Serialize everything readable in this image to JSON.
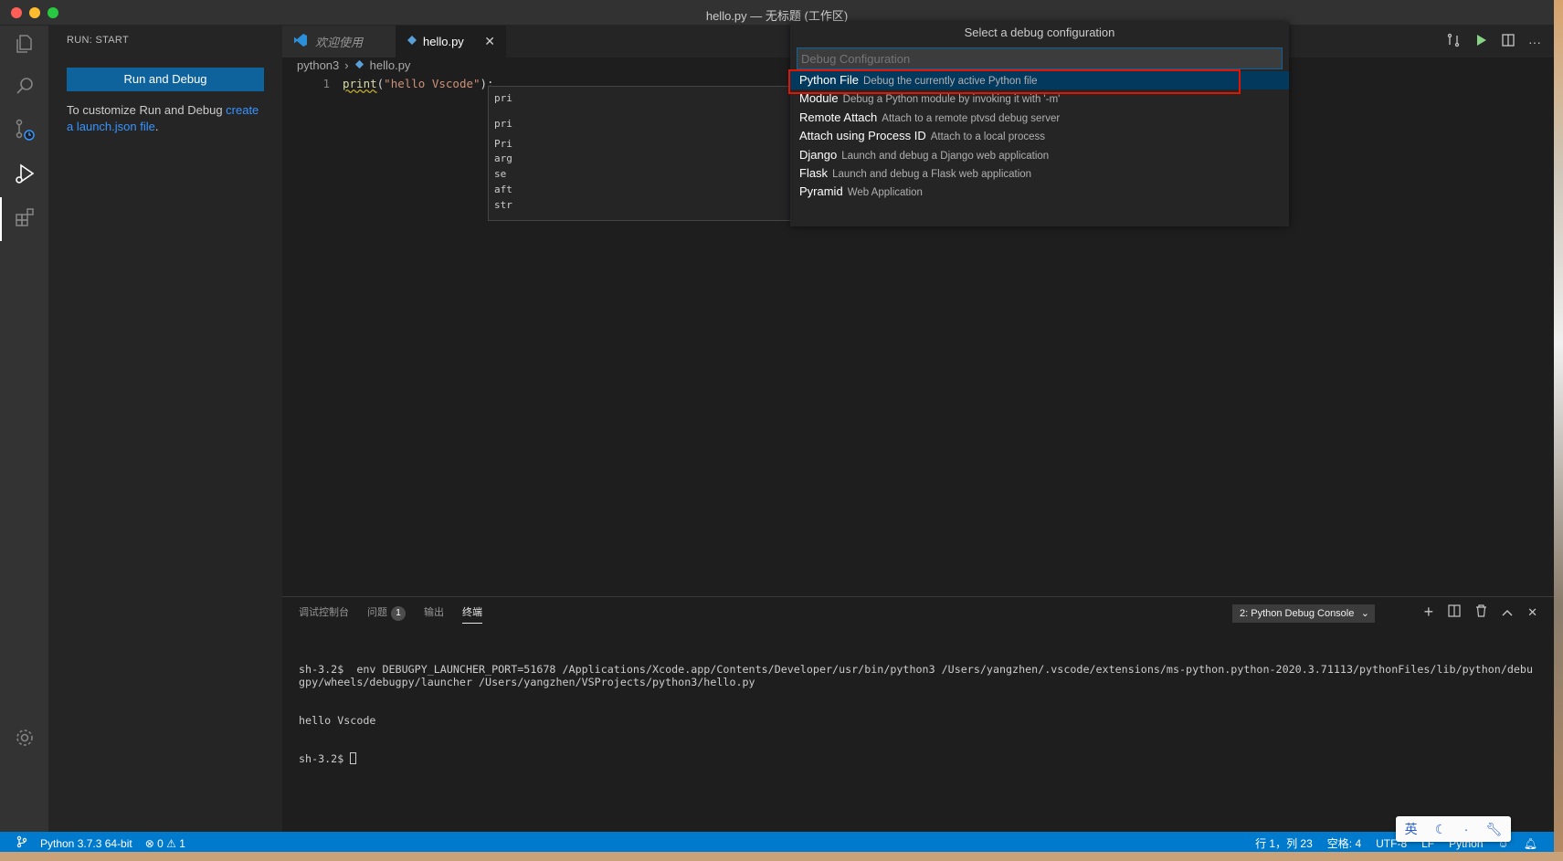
{
  "window": {
    "title": "hello.py — 无标题 (工作区)"
  },
  "sidebar": {
    "title": "RUN: START",
    "run_button": "Run and Debug",
    "hint_prefix": "To customize Run and Debug ",
    "hint_link": "create a launch.json file",
    "hint_suffix": "."
  },
  "tabs": [
    {
      "label": "欢迎使用"
    },
    {
      "label": "hello.py"
    }
  ],
  "breadcrumb": {
    "folder": "python3",
    "file": "hello.py"
  },
  "editor": {
    "line_number": "1",
    "code_fn": "print",
    "code_open": "(",
    "code_str": "\"hello Vscode\"",
    "code_close": ");"
  },
  "suggest": {
    "lines": [
      "pri",
      "pri",
      "Pri",
      "arg",
      "se",
      "aft",
      "str"
    ]
  },
  "quick_pick": {
    "title": "Select a debug configuration",
    "placeholder": "Debug Configuration",
    "items": [
      {
        "label": "Python File",
        "description": "Debug the currently active Python file"
      },
      {
        "label": "Module",
        "description": "Debug a Python module by invoking it with '-m'"
      },
      {
        "label": "Remote Attach",
        "description": "Attach to a remote ptvsd debug server"
      },
      {
        "label": "Attach using Process ID",
        "description": "Attach to a local process"
      },
      {
        "label": "Django",
        "description": "Launch and debug a Django web application"
      },
      {
        "label": "Flask",
        "description": "Launch and debug a Flask web application"
      },
      {
        "label": "Pyramid",
        "description": "Web Application"
      }
    ]
  },
  "panel": {
    "tabs": [
      "调试控制台",
      "问题",
      "输出",
      "终端"
    ],
    "problems_count": "1",
    "terminal_select": "2: Python Debug Console",
    "terminal_lines": [
      "sh-3.2$  env DEBUGPY_LAUNCHER_PORT=51678 /Applications/Xcode.app/Contents/Developer/usr/bin/python3 /Users/yangzhen/.vscode/extensions/ms-python.python-2020.3.71113/pythonFiles/lib/python/debugpy/wheels/debugpy/launcher /Users/yangzhen/VSProjects/python3/hello.py",
      "hello Vscode"
    ],
    "prompt": "sh-3.2$ "
  },
  "statusbar": {
    "interpreter": "Python 3.7.3 64-bit",
    "errors": "0",
    "warnings": "1",
    "position": "行 1，列 23",
    "indent": "空格: 4",
    "encoding": "UTF-8",
    "eol": "LF",
    "language": "Python"
  },
  "ime": {
    "label": "英"
  },
  "colors": {
    "accent": "#007acc",
    "button": "#0e639c",
    "selection_highlight": "#e51400"
  }
}
